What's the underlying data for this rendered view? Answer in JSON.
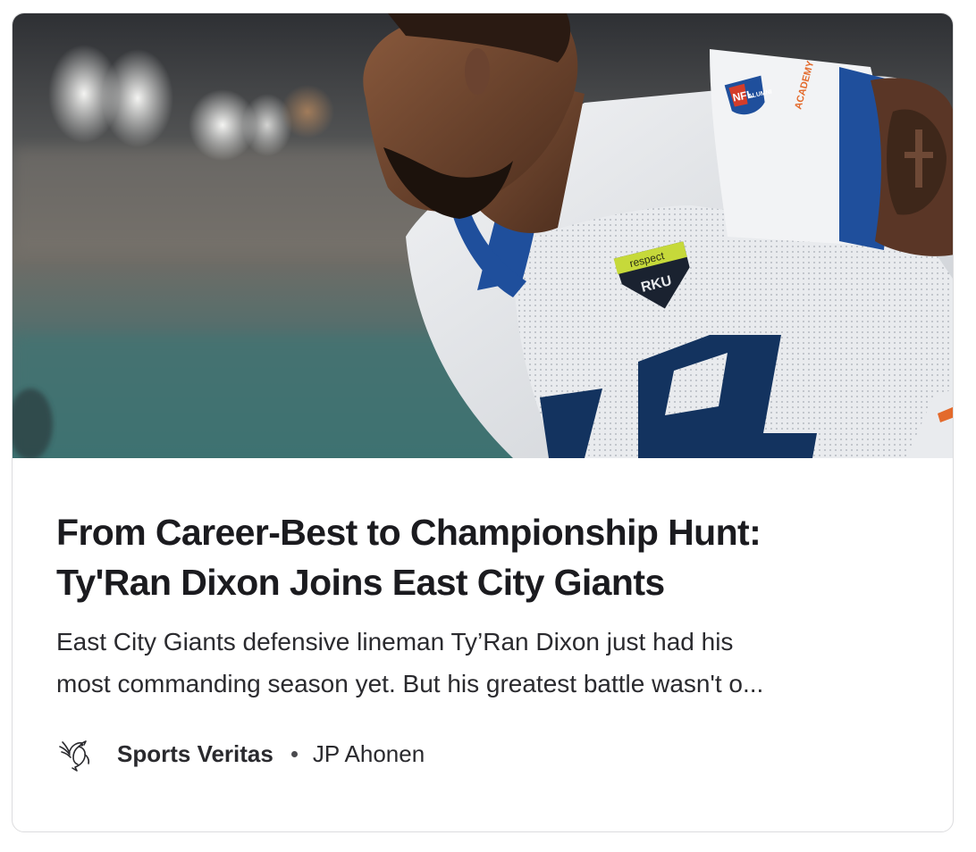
{
  "article": {
    "image_alt": "Defensive lineman in white and blue jersey leaning forward on the field",
    "image_visible_marks": {
      "jersey_badge_top": "respect",
      "jersey_badge_bottom": "RKU",
      "sleeve_patch": "NFL ALUMNI",
      "sleeve_text": "ACADEMY",
      "jersey_number": "4"
    },
    "title_line1": "From Career-Best to Championship Hunt:",
    "title_line2": "Ty'Ran Dixon Joins East City Giants",
    "excerpt_line1": "East City Giants defensive lineman Ty’Ran Dixon just had his",
    "excerpt_line2": "most commanding season yet. But his greatest battle wasn't o..."
  },
  "meta": {
    "publisher_logo_icon": "phoenix-icon",
    "publisher": "Sports Veritas",
    "separator": "•",
    "author": "JP Ahonen"
  },
  "colors": {
    "jersey_blue": "#1f4f9c",
    "jersey_navy": "#13335f",
    "badge_green": "#c6d93a",
    "title_text": "#1b1b1f",
    "border": "#dcdcde"
  }
}
